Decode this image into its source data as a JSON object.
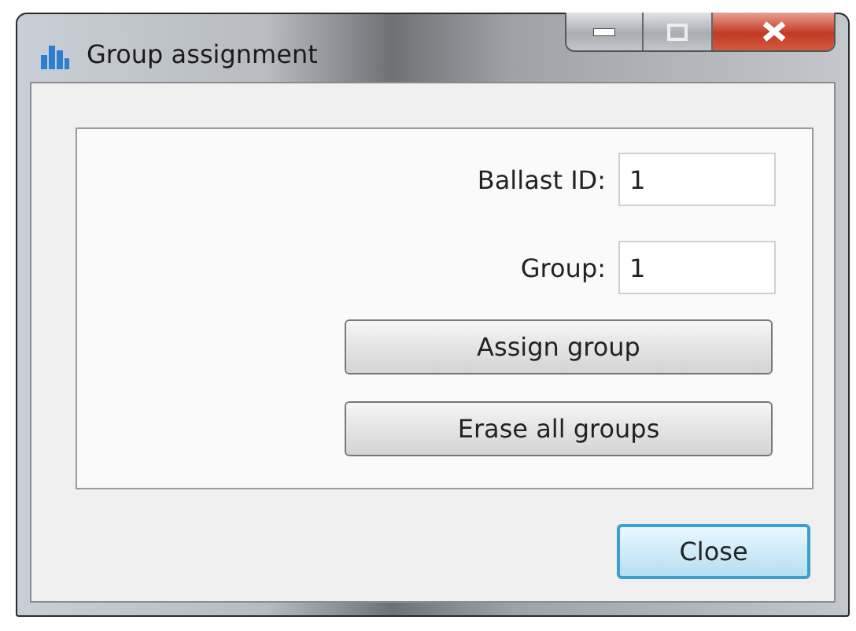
{
  "window": {
    "title": "Group assignment"
  },
  "fields": [
    {
      "label": "Ballast ID:",
      "value": "1"
    },
    {
      "label": "Group:",
      "value": "1"
    }
  ],
  "actions": [
    "Assign group",
    "Erase all groups"
  ],
  "close_button": {
    "label": "Close",
    "focused": true
  }
}
